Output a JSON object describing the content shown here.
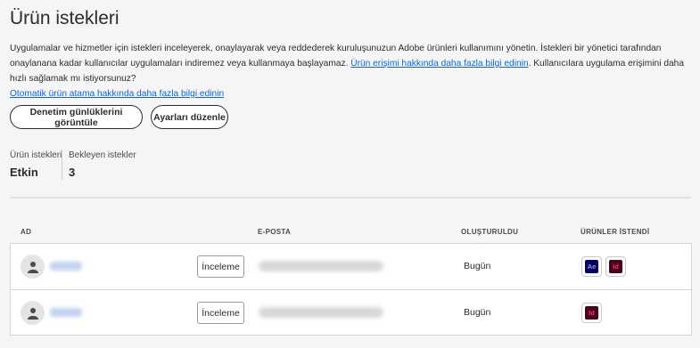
{
  "page": {
    "title": "Ürün istekleri",
    "description_part1": "Uygulamalar ve hizmetler için istekleri inceleyerek, onaylayarak veya reddederek kuruluşunuzun Adobe ürünleri kullanımını yönetin. İstekleri bir yönetici tarafından onaylanana kadar kullanıcılar uygulamaları indiremez veya kullanmaya başlayamaz. ",
    "link_learn_access": "Ürün erişimi hakkında daha fazla bilgi edinin",
    "description_part2": ". Kullanıcılara uygulama erişimini daha hızlı sağlamak mı istiyorsunuz?",
    "link_auto_assign": "Otomatik ürün atama hakkında daha fazla bilgi edinin"
  },
  "buttons": {
    "audit_logs": "Denetim günlüklerini görüntüle",
    "edit_settings": "Ayarları düzenle"
  },
  "stats": {
    "requests_label": "Ürün istekleri",
    "requests_value": "Etkin",
    "pending_label": "Bekleyen istekler",
    "pending_value": "3"
  },
  "table": {
    "headers": {
      "name": "AD",
      "email": "E-POSTA",
      "created": "OLUŞTURULDU",
      "products": "ÜRÜNLER İSTENDİ"
    },
    "rows": [
      {
        "name": "",
        "email": "",
        "review_label": "İnceleme",
        "created": "Bugün",
        "products": [
          "Ae",
          "Id"
        ]
      },
      {
        "name": "",
        "email": "",
        "review_label": "İnceleme",
        "created": "Bugün",
        "products": [
          "Id"
        ]
      }
    ]
  },
  "colors": {
    "link": "#0d66d0",
    "after_effects_bg": "#00005b",
    "after_effects_fg": "#9999ff",
    "indesign_bg": "#49021f",
    "indesign_fg": "#ff3366"
  },
  "icons": {
    "avatar": "user-icon",
    "after_effects": "after-effects-icon",
    "indesign": "indesign-icon"
  }
}
